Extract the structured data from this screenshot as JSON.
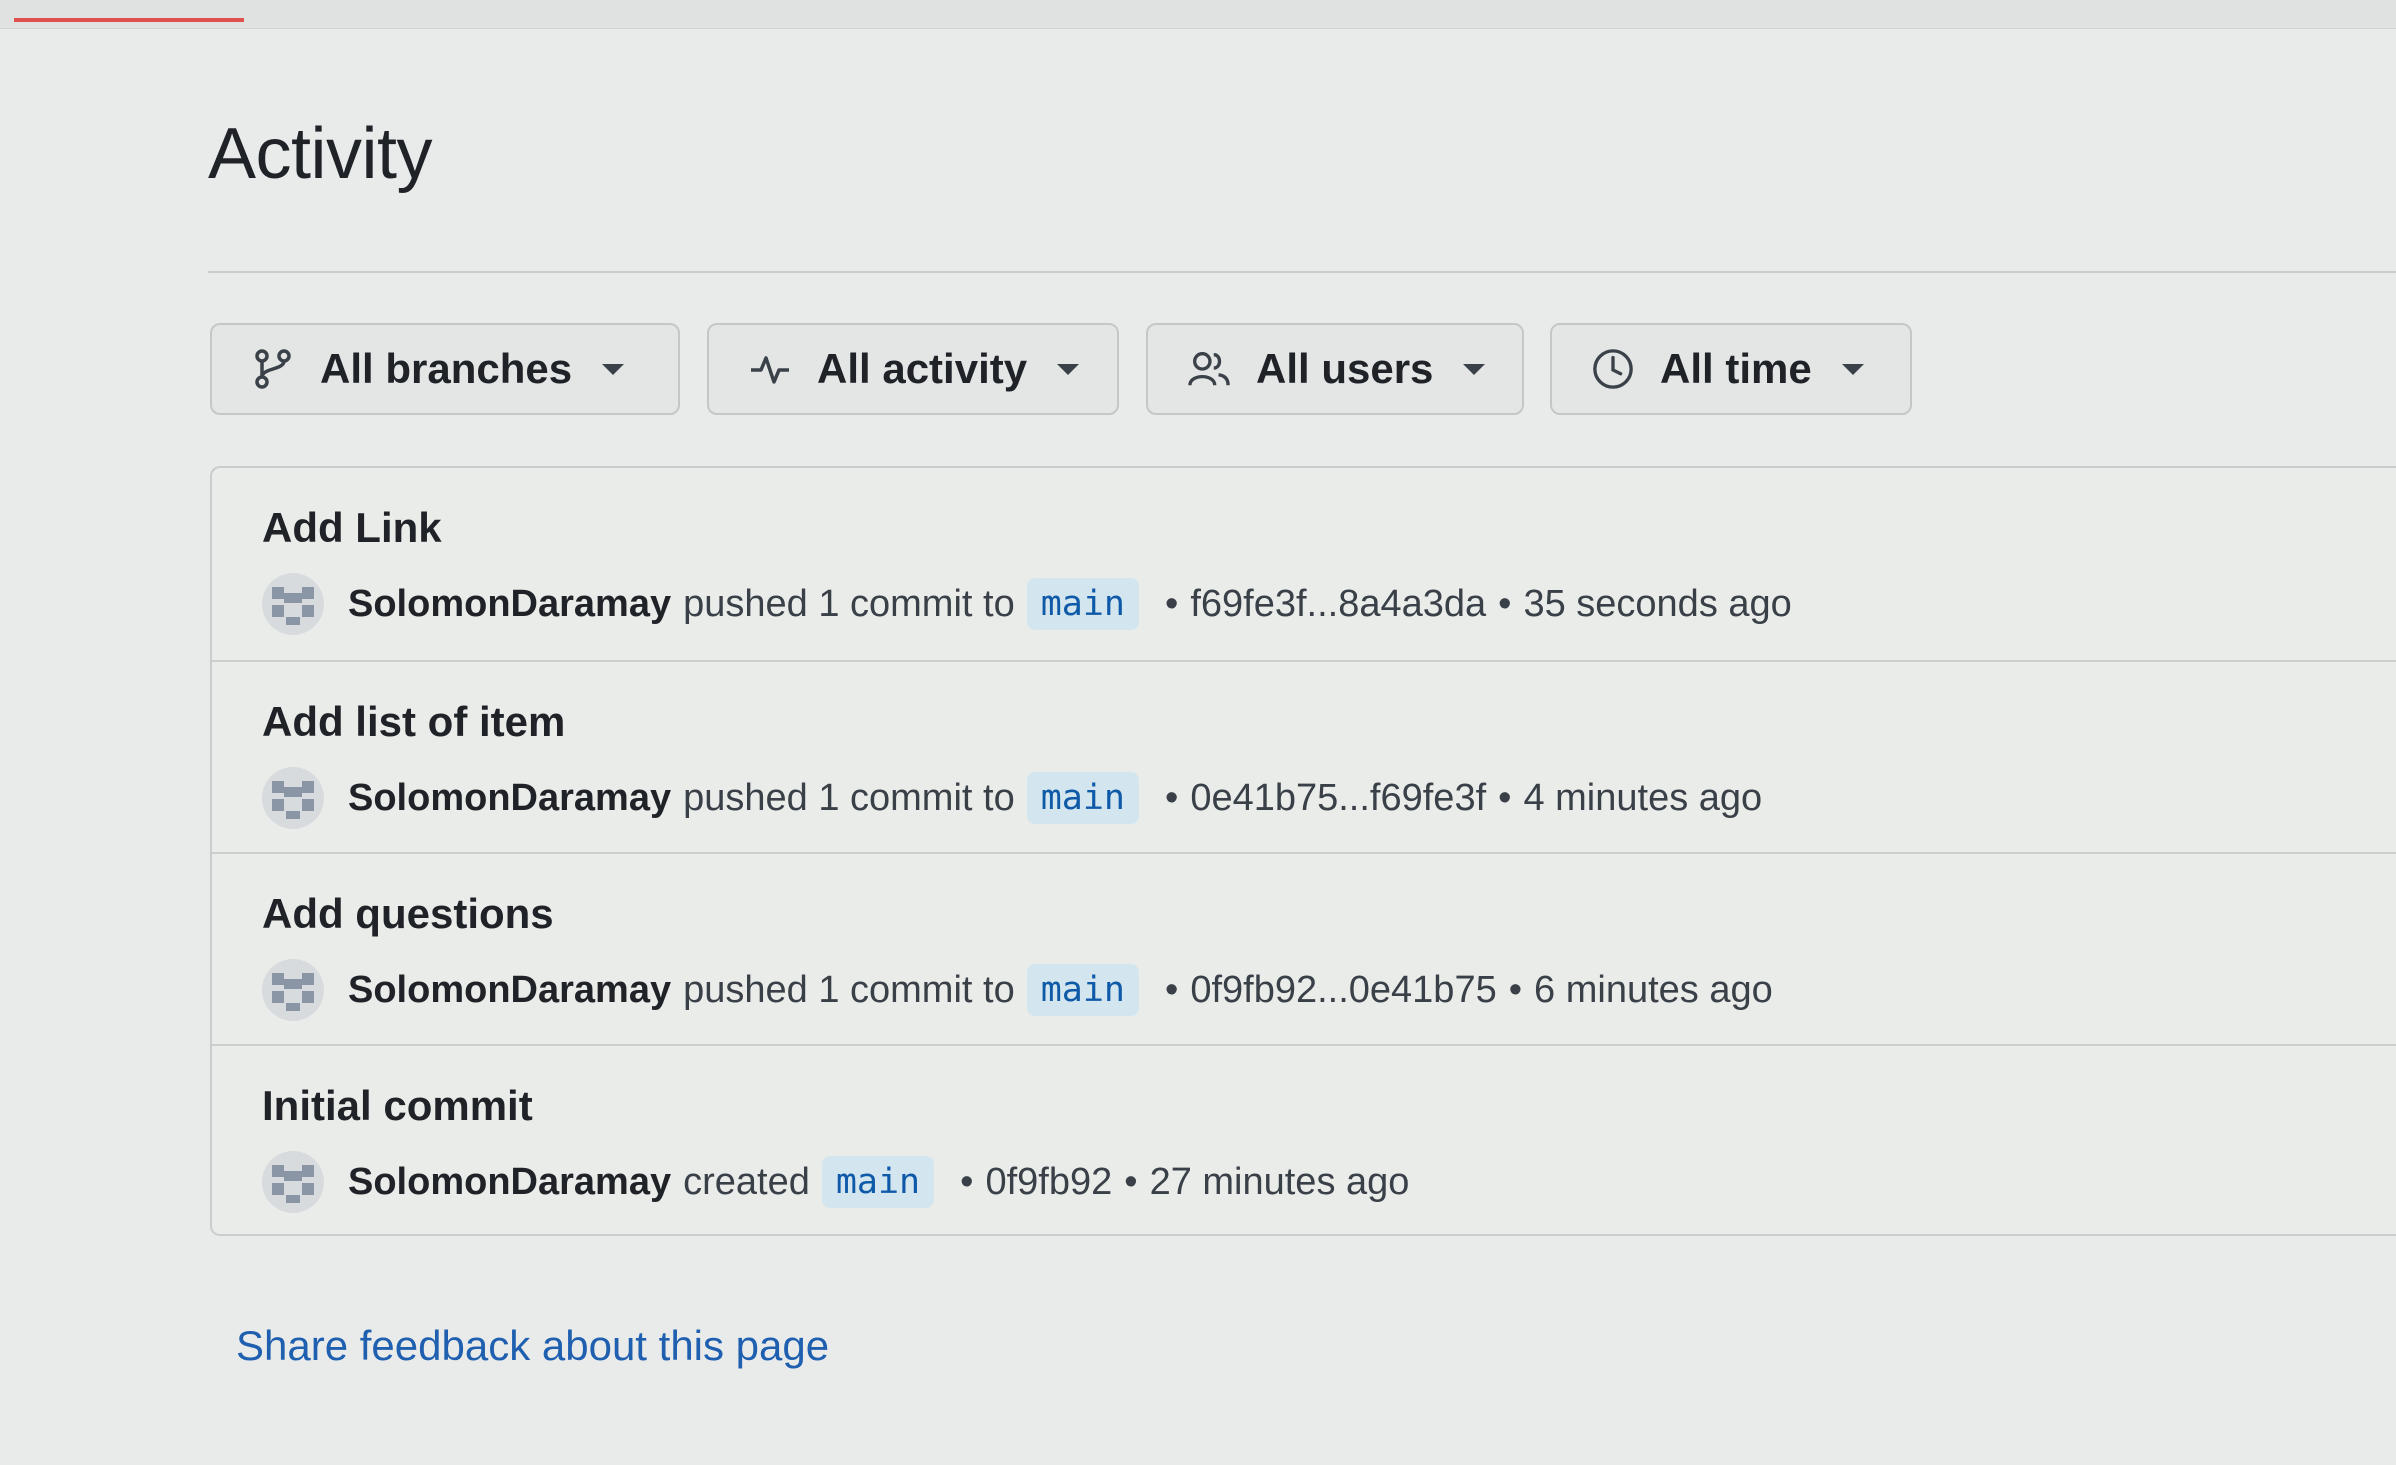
{
  "page": {
    "title": "Activity"
  },
  "filters": [
    {
      "label": "All branches",
      "icon": "git-branch-icon"
    },
    {
      "label": "All activity",
      "icon": "pulse-icon"
    },
    {
      "label": "All users",
      "icon": "people-icon"
    },
    {
      "label": "All time",
      "icon": "clock-icon"
    }
  ],
  "activity": [
    {
      "message": "Add Link",
      "user": "SolomonDaramay",
      "action": "pushed 1 commit to",
      "branch": "main",
      "sha": "f69fe3f...8a4a3da",
      "time": "35 seconds ago"
    },
    {
      "message": "Add list of item",
      "user": "SolomonDaramay",
      "action": "pushed 1 commit to",
      "branch": "main",
      "sha": "0e41b75...f69fe3f",
      "time": "4 minutes ago"
    },
    {
      "message": "Add questions",
      "user": "SolomonDaramay",
      "action": "pushed 1 commit to",
      "branch": "main",
      "sha": "0f9fb92...0e41b75",
      "time": "6 minutes ago"
    },
    {
      "message": "Initial commit",
      "user": "SolomonDaramay",
      "action": "created",
      "branch": "main",
      "sha": "0f9fb92",
      "time": "27 minutes ago"
    }
  ],
  "separator": "•",
  "footer": {
    "feedback_link": "Share feedback about this page"
  },
  "colors": {
    "link": "#1f5fb0",
    "branch_bg": "#d3e6ef",
    "branch_text": "#0f5aa8"
  }
}
